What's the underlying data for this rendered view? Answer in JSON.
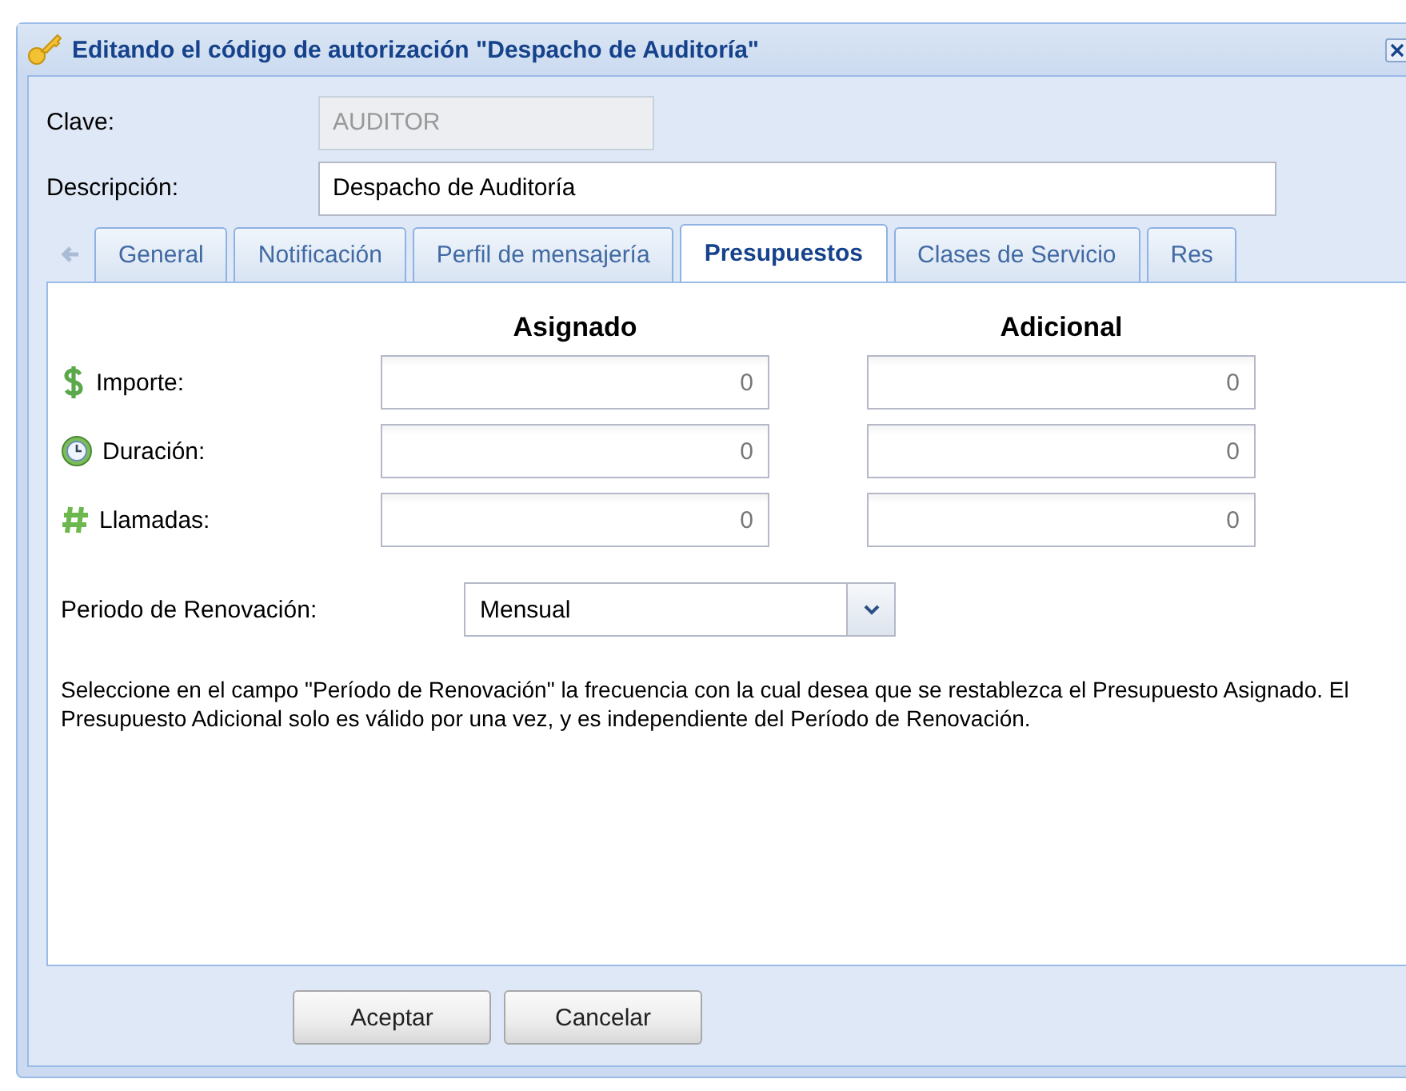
{
  "window": {
    "title": "Editando el código de autorización \"Despacho de Auditoría\""
  },
  "fields": [
    {
      "label": "Clave:",
      "value": "AUDITOR",
      "disabled": true
    },
    {
      "label": "Descripción:",
      "value": "Despacho de Auditoría",
      "disabled": false
    }
  ],
  "tabs": [
    {
      "label": "General",
      "selected": false
    },
    {
      "label": "Notificación",
      "selected": false
    },
    {
      "label": "Perfil de mensajería",
      "selected": false
    },
    {
      "label": "Presupuestos",
      "selected": true
    },
    {
      "label": "Clases de Servicio",
      "selected": false
    },
    {
      "label": "Res",
      "selected": false
    }
  ],
  "budget": {
    "columns": [
      "Asignado",
      "Adicional"
    ],
    "rows": [
      {
        "kind": "money",
        "label": "Importe:",
        "values": [
          "0",
          "0"
        ]
      },
      {
        "kind": "time",
        "label": "Duración:",
        "values": [
          "0",
          "0"
        ]
      },
      {
        "kind": "count",
        "label": "Llamadas:",
        "values": [
          "0",
          "0"
        ]
      }
    ]
  },
  "renewal": {
    "label": "Periodo de Renovación:",
    "value": "Mensual"
  },
  "note": "Seleccione en el campo \"Período de Renovación\" la frecuencia con la cual desea que se restablezca el Presupuesto Asignado. El Presupuesto Adicional solo es válido por una vez, y es independiente del Período de Renovación.",
  "buttons": [
    "Aceptar",
    "Cancelar"
  ]
}
